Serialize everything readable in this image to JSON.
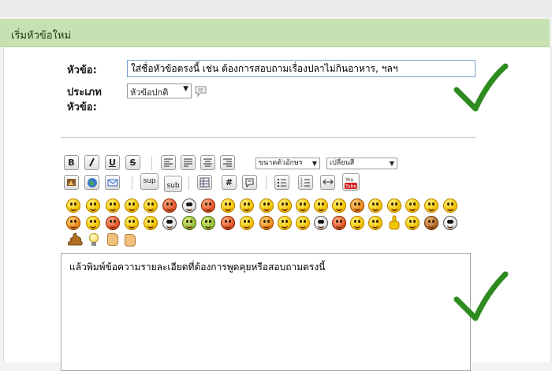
{
  "header": {
    "title": "เริ่มหัวข้อใหม่"
  },
  "form": {
    "subject_label": "หัวข้อ:",
    "subject_value": "ใส่ชื่อหัวข้อตรงนี้ เช่น ต้องการสอบถามเรื่องปลาไม่กินอาหาร, ฯลฯ",
    "type_label_line1": "ประเภท",
    "type_label_line2": "หัวข้อ:",
    "type_selected": "หัวข้อปกติ",
    "message_text": "แล้วพิมพ์ข้อความรายละเอียดที่ต้องการพูดคุยหรือสอบถามตรงนี้"
  },
  "toolbar": {
    "bold": "B",
    "underline": "U",
    "strike": "S",
    "font_size_select": "ขนาดตัวอักษร",
    "font_color_select": "เปลี่ยนสี",
    "sup": "sup",
    "sub": "sub",
    "hash": "#"
  },
  "icons": {
    "check_color": "#2e8b1f",
    "header_bg": "#c6e2b3",
    "names": [
      "bold-icon",
      "italic-icon",
      "underline-icon",
      "strike-icon",
      "align-left-icon",
      "align-justify-icon",
      "align-center-icon",
      "align-right-icon",
      "flash-icon",
      "globe-icon",
      "email-icon",
      "table-icon",
      "hash-icon",
      "quote-icon",
      "list-icon",
      "numbered-list-icon",
      "hr-icon",
      "youtube-icon"
    ]
  }
}
